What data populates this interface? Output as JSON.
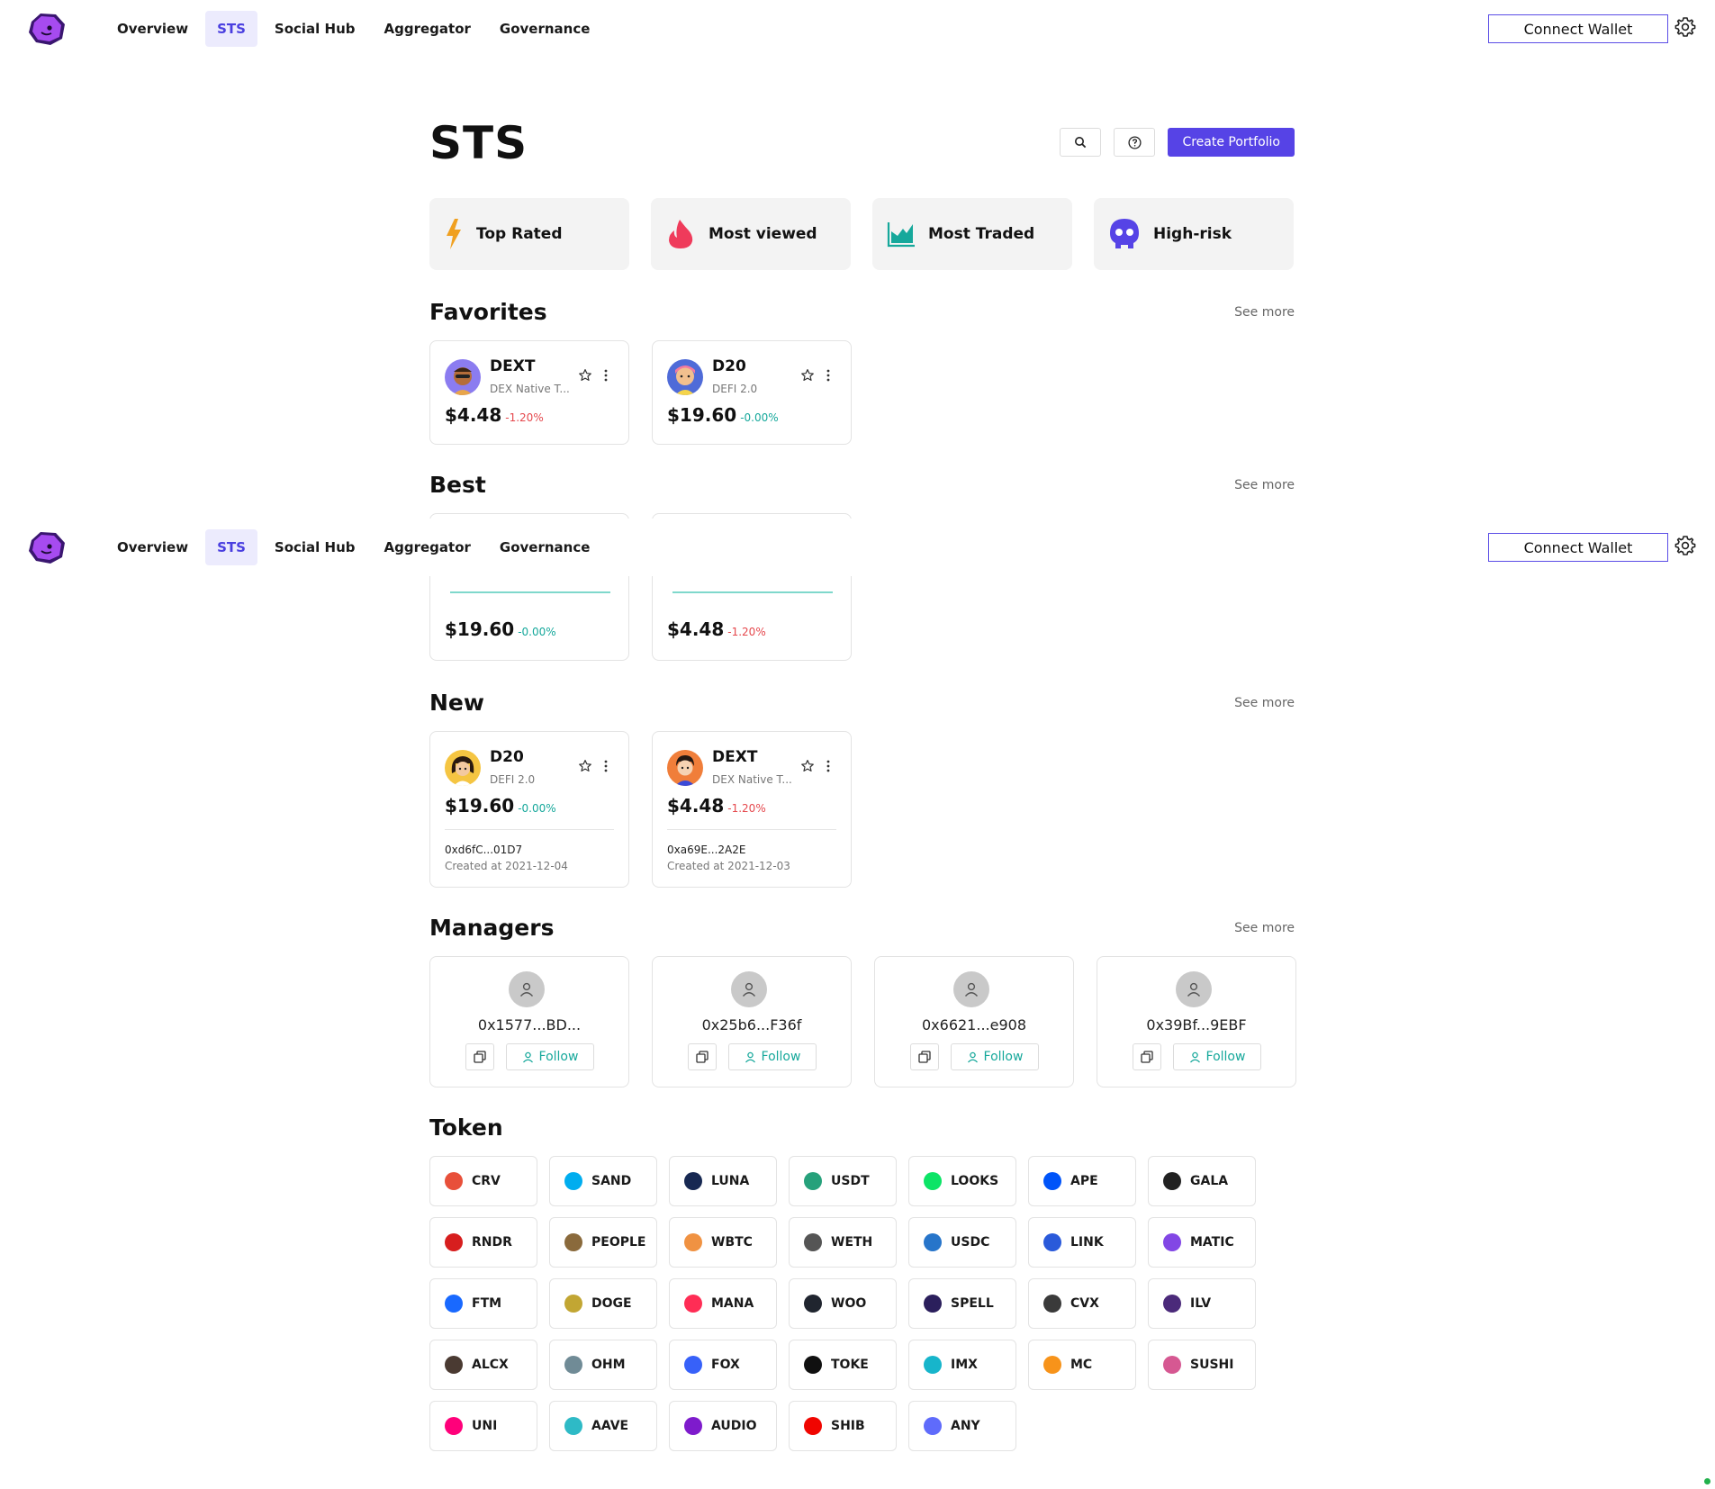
{
  "nav": {
    "links": [
      "Overview",
      "STS",
      "Social Hub",
      "Aggregator",
      "Governance"
    ],
    "active": "STS",
    "connect_label": "Connect Wallet"
  },
  "page": {
    "title": "STS",
    "create_label": "Create Portfolio"
  },
  "categories": [
    {
      "label": "Top Rated",
      "icon": "lightning-icon",
      "color": "#f0a020"
    },
    {
      "label": "Most viewed",
      "icon": "flame-icon",
      "color": "#ef3b5b"
    },
    {
      "label": "Most Traded",
      "icon": "area-chart-icon",
      "color": "#16a89b"
    },
    {
      "label": "High-risk",
      "icon": "skull-icon",
      "color": "#5643e6"
    }
  ],
  "sections": {
    "favorites": "Favorites",
    "best": "Best",
    "new": "New",
    "managers": "Managers",
    "token": "Token",
    "see_more": "See more"
  },
  "favorites": [
    {
      "name": "DEXT",
      "sub": "DEX Native T...",
      "price": "$4.48",
      "change": "-1.20%",
      "trend": "neg"
    },
    {
      "name": "D20",
      "sub": "DEFI 2.0",
      "price": "$19.60",
      "change": "-0.00%",
      "trend": "pos"
    }
  ],
  "best": [
    {
      "price": "$19.60",
      "change": "-0.00%",
      "trend": "pos"
    },
    {
      "price": "$4.48",
      "change": "-1.20%",
      "trend": "neg"
    }
  ],
  "new_items": [
    {
      "name": "D20",
      "sub": "DEFI 2.0",
      "price": "$19.60",
      "change": "-0.00%",
      "trend": "pos",
      "address": "0xd6fC...01D7",
      "created": "Created at 2021-12-04"
    },
    {
      "name": "DEXT",
      "sub": "DEX Native T...",
      "price": "$4.48",
      "change": "-1.20%",
      "trend": "neg",
      "address": "0xa69E...2A2E",
      "created": "Created at 2021-12-03"
    }
  ],
  "managers": [
    {
      "address": "0x1577...BD...",
      "follow": "Follow"
    },
    {
      "address": "0x25b6...F36f",
      "follow": "Follow"
    },
    {
      "address": "0x6621...e908",
      "follow": "Follow"
    },
    {
      "address": "0x39Bf...9EBF",
      "follow": "Follow"
    }
  ],
  "tokens": [
    {
      "name": "CRV",
      "color": "#e8503a"
    },
    {
      "name": "SAND",
      "color": "#00adef"
    },
    {
      "name": "LUNA",
      "color": "#172852"
    },
    {
      "name": "USDT",
      "color": "#26a17b"
    },
    {
      "name": "LOOKS",
      "color": "#0ce466"
    },
    {
      "name": "APE",
      "color": "#0054f9"
    },
    {
      "name": "GALA",
      "color": "#222222"
    },
    {
      "name": "RNDR",
      "color": "#d71e1e"
    },
    {
      "name": "PEOPLE",
      "color": "#8a6a3c"
    },
    {
      "name": "WBTC",
      "color": "#f09242"
    },
    {
      "name": "WETH",
      "color": "#555555"
    },
    {
      "name": "USDC",
      "color": "#2775ca"
    },
    {
      "name": "LINK",
      "color": "#2a5ada"
    },
    {
      "name": "MATIC",
      "color": "#8247e5"
    },
    {
      "name": "FTM",
      "color": "#1969ff"
    },
    {
      "name": "DOGE",
      "color": "#c2a633"
    },
    {
      "name": "MANA",
      "color": "#ff2d55"
    },
    {
      "name": "WOO",
      "color": "#20252f"
    },
    {
      "name": "SPELL",
      "color": "#2b1f5c"
    },
    {
      "name": "CVX",
      "color": "#3a3a3a"
    },
    {
      "name": "ILV",
      "color": "#4b2a7a"
    },
    {
      "name": "ALCX",
      "color": "#4a3a32"
    },
    {
      "name": "OHM",
      "color": "#708b96"
    },
    {
      "name": "FOX",
      "color": "#3761f9"
    },
    {
      "name": "TOKE",
      "color": "#101010"
    },
    {
      "name": "IMX",
      "color": "#17b5cb"
    },
    {
      "name": "MC",
      "color": "#f7931a"
    },
    {
      "name": "SUSHI",
      "color": "#d65892"
    },
    {
      "name": "UNI",
      "color": "#ff007a"
    },
    {
      "name": "AAVE",
      "color": "#2ebac6"
    },
    {
      "name": "AUDIO",
      "color": "#7e1bcc"
    },
    {
      "name": "SHIB",
      "color": "#f00500"
    },
    {
      "name": "ANY",
      "color": "#5f6bfb"
    }
  ],
  "colors": {
    "accent": "#5643e6",
    "active_bg": "#ecebfd",
    "positive": "#16a89b",
    "negative": "#e5484d"
  }
}
